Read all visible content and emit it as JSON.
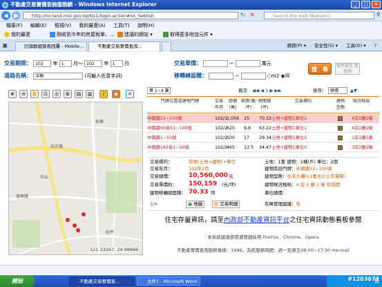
{
  "window": {
    "title": "不動產交易實價查詢服務網 - Windows Internet Explorer",
    "controls": [
      "_",
      "□",
      "×"
    ]
  },
  "address_bar": {
    "url": "http://lvr.land.moi.gov.tw/N11/login.action#lvt_Seblish",
    "search_placeholder": "Search the web (Babylon)"
  },
  "menu": [
    "檔案(F)",
    "編輯(E)",
    "檢視(V)",
    "我的最愛(A)",
    "工具(T)",
    "說明(H)"
  ],
  "favorites": {
    "label": "我的最愛",
    "items": [
      "剛收到今年的房屋稅單，…",
      "建議的網站 ▾",
      "取得更多附加元件 ▾"
    ]
  },
  "tabs": [
    {
      "label": "討論群組發表回覆 - Mobile…"
    },
    {
      "label": "不動產交易實價查詢…"
    }
  ],
  "ie_tools": [
    "網頁(P) ▾",
    "安全性(S) ▾",
    "工具(O) ▾",
    "?"
  ],
  "form": {
    "date_label": "交易期間：",
    "date_values": [
      "102",
      "1",
      "102",
      "1"
    ],
    "date_units": [
      "年",
      "月～",
      "年",
      "月"
    ],
    "price_label": "交易單價：",
    "price_unit": "萬元",
    "area_label": "移轉總面積：",
    "area_opt1": "m2",
    "area_opt2": "坪",
    "road_label": "道路名稱：",
    "road_value": "中興",
    "road_hint": "(可輸入任意字詞)",
    "search_button": "搜　尋",
    "cond_button": "條件設定 新查詢"
  },
  "map": {
    "coords": "121.33267, 24.98866",
    "roads": [
      "中正路",
      "復興路",
      "永興",
      "和平",
      "中山"
    ]
  },
  "results": {
    "page_select": "第 1~4 筆",
    "page_label": "頁次",
    "pager": "◀◀ ◀ 1 ▶ ▶▶",
    "sort_label": "排序：",
    "sort_value": "總價",
    "columns": [
      "門牌位置或建物門牌",
      "交易年月",
      "總價(萬)",
      "單價(萬/坪)",
      "總面積(坪)",
      "交易標的",
      "建物型態",
      "現況格局"
    ],
    "rows": [
      {
        "addr": "中興路51~100號",
        "date": "102/1",
        "total": "1,056",
        "unit": "15",
        "area": "70.33",
        "target": "土地+建物1車位2",
        "layout": "4房2廳2衛"
      },
      {
        "addr": "中興路90巷51~100號",
        "date": "102/2",
        "total": "620",
        "unit": "9.8",
        "area": "63.22",
        "target": "土地+建物1車位1",
        "layout": "4房2廳2衛"
      },
      {
        "addr": "中興路1~50號",
        "date": "102/2",
        "total": "500",
        "unit": "17",
        "area": "29.34",
        "target": "土地+建物1車位0",
        "layout": "1房1廳1衛"
      },
      {
        "addr": "中興路182巷1~50號",
        "date": "102/2",
        "total": "465",
        "unit": "13.5",
        "area": "34.47",
        "target": "土地+建物1車位0",
        "layout": "3房2廳2衛"
      }
    ]
  },
  "detail": {
    "left": [
      {
        "k": "交易標的：",
        "v": "房地(土地+建物)+車位"
      },
      {
        "k": "交易年月：",
        "v": "102年1月"
      },
      {
        "k": "交易總價：",
        "v": "10,560,000",
        "unit": "元"
      },
      {
        "k": "交易單價約：",
        "v": "150,159",
        "unit": "(元/坪)"
      },
      {
        "k": "建物移轉總面積：",
        "v": "70.33",
        "unit": "坪"
      }
    ],
    "right": [
      {
        "k": "土地：",
        "v": "1筆 建物：1棟(戶) 車位：2個"
      },
      {
        "k": "建物區段門牌：",
        "v": "中興路51~100號"
      },
      {
        "k": "建物型態：",
        "v": "住宅大樓(11層含以上有電梯)"
      },
      {
        "k": "建物現況格局：",
        "v": "4 房 2 廳 2 衛 有隔間"
      },
      {
        "k": "車位總價：",
        "v": ""
      },
      {
        "k": "有無管理組織：",
        "v": "有"
      }
    ],
    "page": "1/4",
    "btn_map": "地圖",
    "btn_detail": "交易明細"
  },
  "banner": {
    "pre": "住宅存量資訊，請至",
    "link": "內政部不動產資訊平台",
    "post": "之住宅資訊動態看板參閱"
  },
  "footer": {
    "line1": "本系統建議使用瀏覽器採用 FireFox、Chrome、Opera",
    "line2": "不動產實價查詢服務專線：1996，為民服務時間：週一至週五08:00~17:30",
    "email": "e-mail"
  },
  "taskbar": {
    "start": "開始",
    "tasks": [
      "不動產交易實價查...",
      "文件1 - Microsoft Word"
    ],
    "tray": "住"
  },
  "watermark": "#1203672",
  "colors": {
    "accent": "#e47b1d",
    "highlight_row": "#f9d0c9",
    "link_red": "#c0232c"
  }
}
